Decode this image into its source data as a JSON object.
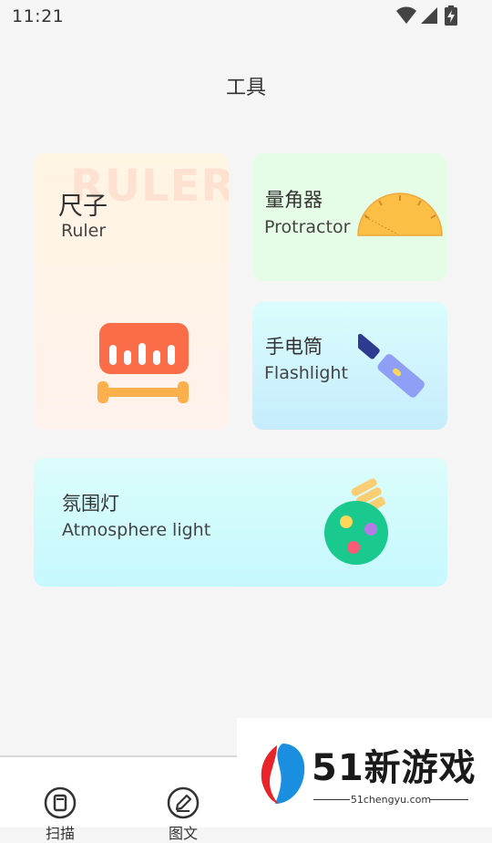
{
  "status_bar": {
    "time": "11:21",
    "icons": [
      "wifi-icon",
      "cell-signal-icon",
      "battery-charging-icon"
    ]
  },
  "page": {
    "title": "工具"
  },
  "tools": {
    "ruler": {
      "title": "尺子",
      "subtitle": "Ruler",
      "watermark": "RULER",
      "icon": "ruler-icon",
      "colors": {
        "body": "#fa6d48",
        "base": "#fcb04c"
      }
    },
    "protractor": {
      "title": "量角器",
      "subtitle": "Protractor",
      "icon": "protractor-icon",
      "colors": {
        "fill": "#fcbf46"
      }
    },
    "flashlight": {
      "title": "手电筒",
      "subtitle": "Flashlight",
      "icon": "flashlight-icon",
      "colors": {
        "body": "#8f9ff5",
        "cap": "#2e3a8f"
      }
    },
    "atmosphere": {
      "title": "氛围灯",
      "subtitle": "Atmosphere light",
      "icon": "potion-bottle-icon",
      "colors": {
        "bottle": "#19c98e",
        "cork": "#fcce73"
      }
    }
  },
  "bottom_nav": {
    "items": [
      {
        "label": "扫描",
        "icon": "scan-icon"
      },
      {
        "label": "图文",
        "icon": "edit-icon"
      }
    ]
  },
  "watermark_logo": {
    "text": "51新游戏",
    "url": "51chengyu.com"
  }
}
